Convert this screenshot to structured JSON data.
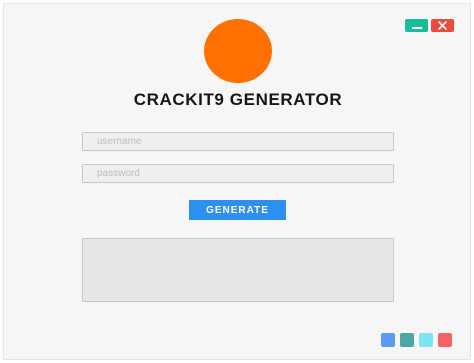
{
  "app": {
    "title": "CRACKIT9  GENERATOR",
    "logo_color": "#ff7000"
  },
  "window_controls": {
    "minimize_icon": "minimize-icon",
    "minimize_color": "#1abc9c",
    "close_icon": "close-icon",
    "close_color": "#e74c3c"
  },
  "form": {
    "username": {
      "placeholder": "username",
      "value": ""
    },
    "password": {
      "placeholder": "password",
      "value": ""
    },
    "generate_label": "GENERATE",
    "generate_color": "#2d8ff0",
    "output": {
      "value": ""
    }
  },
  "theme_swatches": [
    {
      "color": "#5b9cf0"
    },
    {
      "color": "#4aa8a6"
    },
    {
      "color": "#7fe3f0"
    },
    {
      "color": "#f26464"
    }
  ]
}
